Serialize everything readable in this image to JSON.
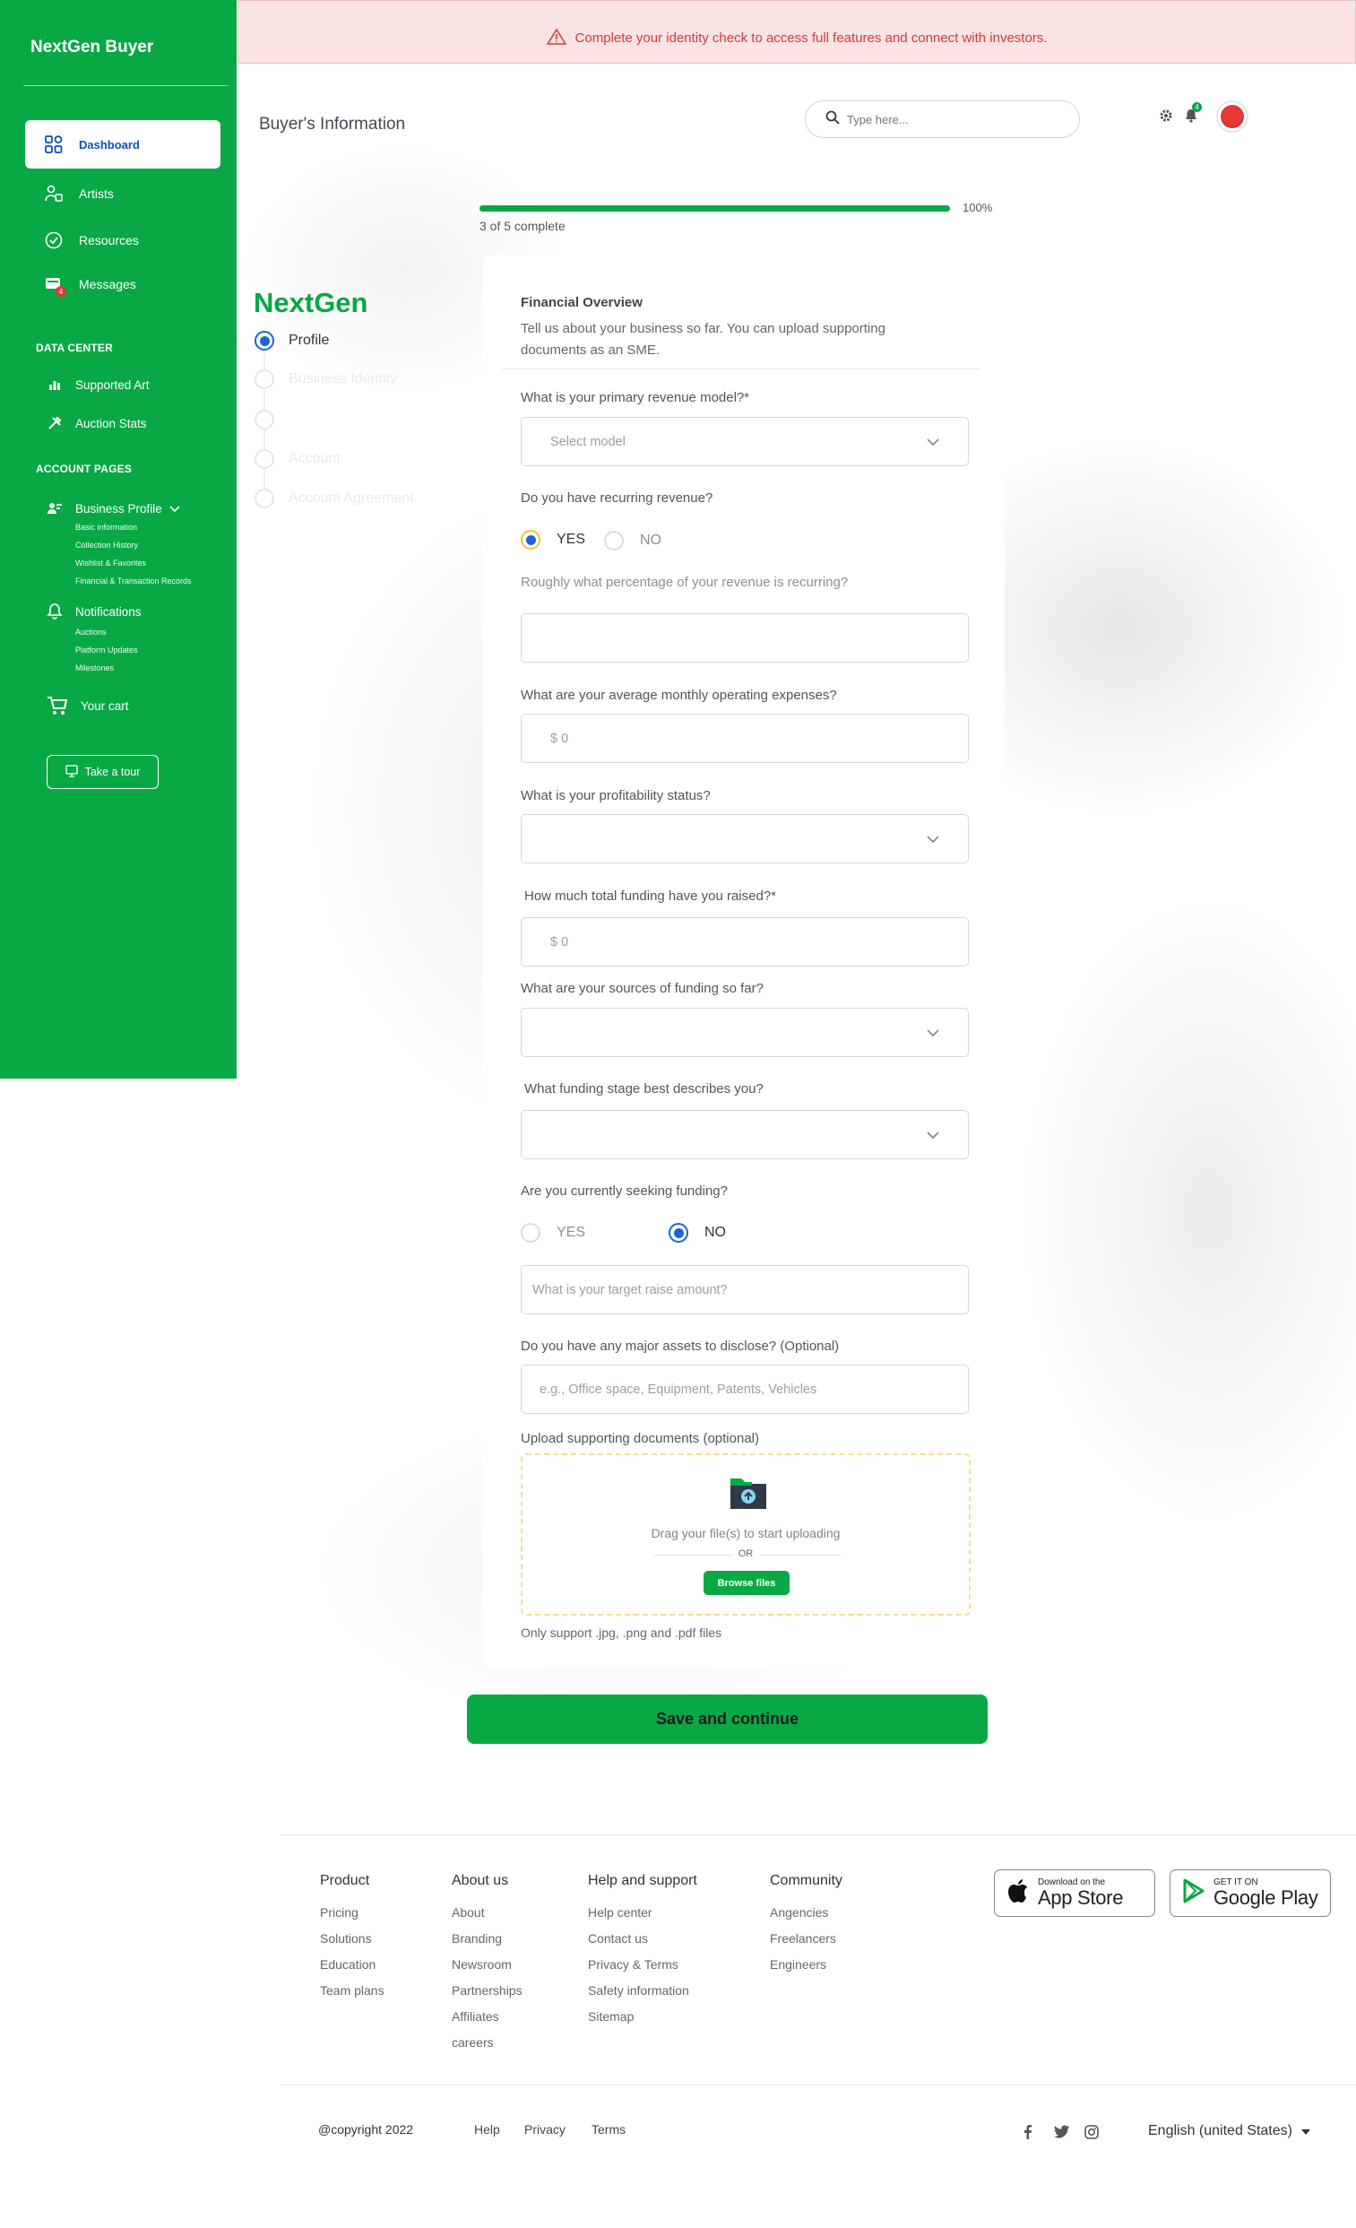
{
  "sidebar": {
    "brand": "NextGen Buyer",
    "items": [
      {
        "label": "Dashboard",
        "icon": "dashboard-icon"
      },
      {
        "label": "Artists",
        "icon": "users-icon"
      },
      {
        "label": "Resources",
        "icon": "check-circle-icon"
      },
      {
        "label": "Messages",
        "icon": "messages-icon",
        "badge": "4"
      }
    ],
    "data_center_title": "DATA CENTER",
    "data_center": [
      {
        "label": "Supported Art",
        "icon": "bar-chart-icon"
      },
      {
        "label": "Auction Stats",
        "icon": "tools-icon"
      }
    ],
    "account_title": "ACCOUNT PAGES",
    "business_profile": {
      "label": "Business Profile",
      "children": [
        "Basic information",
        "Collection History",
        "Wishlist & Favorites",
        "Financial & Transaction Records"
      ]
    },
    "notifications": {
      "label": "Notifications",
      "children": [
        "Auctions",
        "Platform Updates",
        "Milestones"
      ]
    },
    "cart": "Your cart",
    "tour": "Take a tour"
  },
  "alert": {
    "text": "Complete your identity check to access full features and connect with investors."
  },
  "header": {
    "title": "Buyer's Information",
    "search_placeholder": "Type here...",
    "notif_badge": "4"
  },
  "progress": {
    "percent_label": "100%",
    "status": "3 of 5 complete",
    "fill_fraction": 1.0
  },
  "stepper": {
    "brand": "NextGen",
    "steps": [
      "Profile",
      "Business Identity",
      "",
      "Account",
      "Account Agreement"
    ]
  },
  "form": {
    "section_title": "Financial Overview",
    "section_desc": "Tell us about your business so far. You can upload supporting documents as an SME.",
    "q_revenue_model": "What is your primary revenue model?*",
    "revenue_model_placeholder": "Select model",
    "q_recurring": "Do you have recurring revenue?",
    "yes": "YES",
    "no": "NO",
    "q_recurring_pct": "Roughly what percentage of your revenue is recurring?",
    "q_opex": "What are your average monthly operating expenses?",
    "opex_placeholder": "$ 0",
    "q_profit": "What is your profitability status?",
    "q_funding_raised": "How much total funding have you raised?*",
    "funding_raised_placeholder": "$ 0",
    "q_sources": "What are your sources of funding so far?",
    "q_stage": "What funding stage best describes you?",
    "q_seeking": "Are you currently seeking funding?",
    "target_raise_placeholder": "What is your target raise amount?",
    "q_assets": "Do you have any major assets to disclose? (Optional)",
    "assets_placeholder": "e.g., Office space, Equipment, Patents, Vehicles",
    "q_upload": "Upload supporting documents (optional)",
    "upload_text": "Drag your file(s) to start uploading",
    "upload_or": "OR",
    "browse": "Browse files",
    "upload_note": "Only support .jpg, .png and .pdf files",
    "save": "Save and continue"
  },
  "footer": {
    "columns": [
      {
        "title": "Product",
        "links": [
          "Pricing",
          "Solutions",
          "Education",
          "Team plans"
        ]
      },
      {
        "title": "About us",
        "links": [
          "About",
          "Branding",
          "Newsroom",
          "Partnerships",
          "Affiliates",
          "careers"
        ]
      },
      {
        "title": "Help and support",
        "links": [
          "Help center",
          "Contact us",
          "Privacy & Terms",
          "Safety information",
          "Sitemap"
        ]
      },
      {
        "title": "Community",
        "links": [
          "Angencies",
          "Freelancers",
          "Engineers"
        ]
      }
    ],
    "app_store": {
      "small": "Download on the",
      "big": "App Store"
    },
    "google_play": {
      "small": "GET IT ON",
      "big": "Google Play"
    },
    "copyright": "@copyright 2022",
    "bottom_links": [
      "Help",
      "Privacy",
      "Terms"
    ],
    "language": "English (united States)"
  }
}
